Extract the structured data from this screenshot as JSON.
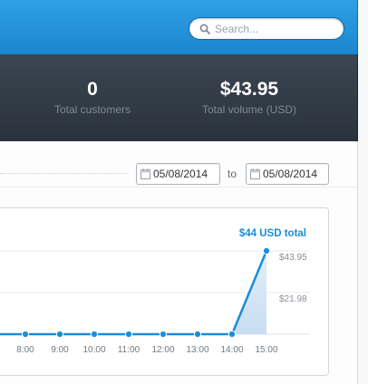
{
  "header": {
    "search": {
      "placeholder": "Search...",
      "value": ""
    }
  },
  "stats": [
    {
      "value": "0",
      "label": "Total customers"
    },
    {
      "value": "$43.95",
      "label": "Total volume (USD)"
    }
  ],
  "date_range": {
    "from": "05/08/2014",
    "to_label": "to",
    "to": "05/08/2014"
  },
  "chart_data": {
    "type": "area",
    "total_label": "$44 USD total",
    "accent_color": "#1a8dd9",
    "x": [
      "8:00",
      "9:00",
      "10:00",
      "11:00",
      "12:00",
      "13:00",
      "14:00",
      "15:00"
    ],
    "values": [
      0,
      0,
      0,
      0,
      0,
      0,
      0,
      0,
      0,
      43.95
    ],
    "y_tick_labels": [
      "$43.95",
      "$21.98"
    ],
    "ylim": [
      0,
      43.95
    ],
    "grid": true
  }
}
